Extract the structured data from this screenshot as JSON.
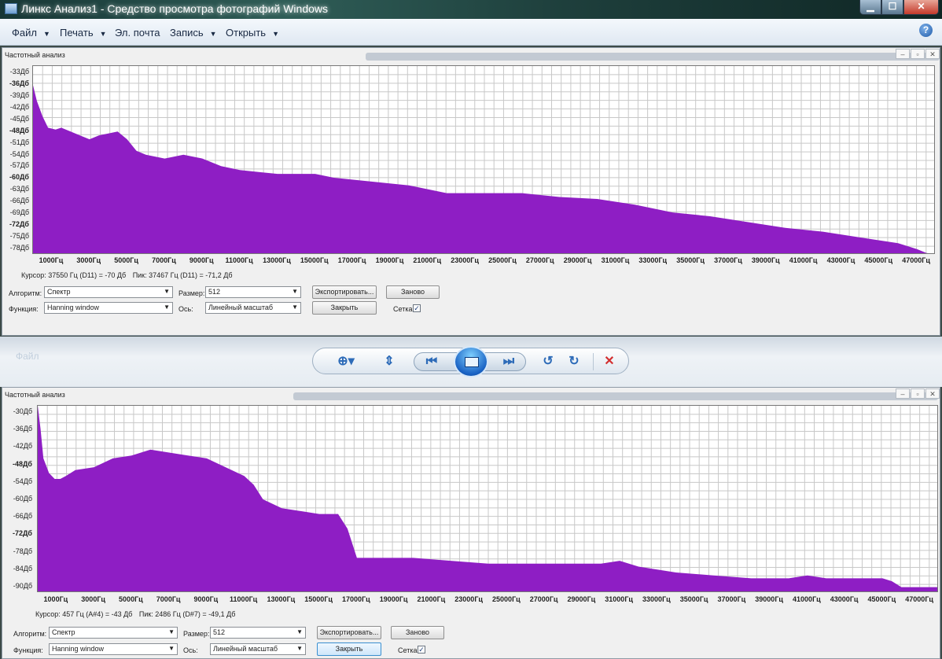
{
  "window": {
    "title": "Линкс Анализ1 - Средство просмотра фотографий Windows"
  },
  "menu": {
    "file": "Файл",
    "print": "Печать",
    "email": "Эл. почта",
    "burn": "Запись",
    "open": "Открыть"
  },
  "colors": {
    "spectrum_fill": "#8e1ec4",
    "grid": "#c8c8c8",
    "background_tint": "#3c4a48"
  },
  "top_panel": {
    "title": "Частотный анализ",
    "status": {
      "cursor": "Курсор: 37550 Гц (D11) = -70 Дб",
      "peak": "Пик: 37467 Гц (D11) = -71,2 Дб"
    },
    "controls": {
      "algorithm_label": "Алгоритм:",
      "algorithm_value": "Спектр",
      "size_label": "Размер:",
      "size_value": "512",
      "export_label": "Экспортировать...",
      "replot_label": "Заново",
      "function_label": "Функция:",
      "function_value": "Hanning window",
      "axis_label": "Ось:",
      "axis_value": "Линейный масштаб",
      "close_label": "Закрыть",
      "grid_label": "Сетка"
    },
    "ylabels": [
      {
        "text": "-33Дб",
        "bold": false
      },
      {
        "text": "-36Дб",
        "bold": true
      },
      {
        "text": "-39Дб",
        "bold": false
      },
      {
        "text": "-42Дб",
        "bold": false
      },
      {
        "text": "-45Дб",
        "bold": false
      },
      {
        "text": "-48Дб",
        "bold": true
      },
      {
        "text": "-51Дб",
        "bold": false
      },
      {
        "text": "-54Дб",
        "bold": false
      },
      {
        "text": "-57Дб",
        "bold": false
      },
      {
        "text": "-60Дб",
        "bold": true
      },
      {
        "text": "-63Дб",
        "bold": false
      },
      {
        "text": "-66Дб",
        "bold": false
      },
      {
        "text": "-69Дб",
        "bold": false
      },
      {
        "text": "-72Дб",
        "bold": true
      },
      {
        "text": "-75Дб",
        "bold": false
      },
      {
        "text": "-78Дб",
        "bold": false
      }
    ],
    "xlabels": [
      "1000Гц",
      "3000Гц",
      "5000Гц",
      "7000Гц",
      "9000Гц",
      "11000Гц",
      "13000Гц",
      "15000Гц",
      "17000Гц",
      "19000Гц",
      "21000Гц",
      "23000Гц",
      "25000Гц",
      "27000Гц",
      "29000Гц",
      "31000Гц",
      "33000Гц",
      "35000Гц",
      "37000Гц",
      "39000Гц",
      "41000Гц",
      "43000Гц",
      "45000Гц",
      "47000Гц"
    ]
  },
  "bottom_panel": {
    "title": "Частотный анализ",
    "status": {
      "cursor": "Курсор: 457 Гц (A#4) = -43 Дб",
      "peak": "Пик: 2486 Гц (D#7) = -49,1 Дб"
    },
    "controls": {
      "algorithm_label": "Алгоритм:",
      "algorithm_value": "Спектр",
      "size_label": "Размер:",
      "size_value": "512",
      "export_label": "Экспортировать...",
      "replot_label": "Заново",
      "function_label": "Функция:",
      "function_value": "Hanning window",
      "axis_label": "Ось:",
      "axis_value": "Линейный масштаб",
      "close_label": "Закрыть",
      "grid_label": "Сетка"
    },
    "ylabels": [
      {
        "text": "-30Дб",
        "bold": false
      },
      {
        "text": "-36Дб",
        "bold": false
      },
      {
        "text": "-42Дб",
        "bold": false
      },
      {
        "text": "-48Дб",
        "bold": true
      },
      {
        "text": "-54Дб",
        "bold": false
      },
      {
        "text": "-60Дб",
        "bold": false
      },
      {
        "text": "-66Дб",
        "bold": false
      },
      {
        "text": "-72Дб",
        "bold": true
      },
      {
        "text": "-78Дб",
        "bold": false
      },
      {
        "text": "-84Дб",
        "bold": false
      },
      {
        "text": "-90Дб",
        "bold": false
      }
    ],
    "xlabels": [
      "1000Гц",
      "3000Гц",
      "5000Гц",
      "7000Гц",
      "9000Гц",
      "11000Гц",
      "13000Гц",
      "15000Гц",
      "17000Гц",
      "19000Гц",
      "21000Гц",
      "23000Гц",
      "25000Гц",
      "27000Гц",
      "29000Гц",
      "31000Гц",
      "33000Гц",
      "35000Гц",
      "37000Гц",
      "39000Гц",
      "41000Гц",
      "43000Гц",
      "45000Гц",
      "47000Гц"
    ]
  },
  "chart_data": [
    {
      "type": "area",
      "x_unit": "Гц",
      "y_unit": "Дб",
      "xlim": [
        0,
        48000
      ],
      "ylim": [
        -80,
        -31
      ],
      "grid": true,
      "x": [
        0,
        200,
        500,
        800,
        1200,
        1500,
        2000,
        2500,
        3000,
        3500,
        4000,
        4500,
        5000,
        5500,
        6000,
        7000,
        8000,
        9000,
        10000,
        11000,
        12000,
        13000,
        14000,
        15000,
        16000,
        18000,
        20000,
        22000,
        24000,
        26000,
        28000,
        30000,
        32000,
        34000,
        36000,
        38000,
        40000,
        42000,
        44000,
        46000,
        47000,
        47500,
        48000
      ],
      "y": [
        -36,
        -40,
        -44,
        -47,
        -47.5,
        -47,
        -48,
        -49,
        -50,
        -49,
        -48.5,
        -48,
        -50,
        -53,
        -54,
        -55,
        -54,
        -55,
        -57,
        -58,
        -58.5,
        -59,
        -59,
        -59,
        -60,
        -61,
        -62,
        -64,
        -64,
        -64,
        -65,
        -65.5,
        -67,
        -69,
        -70,
        -71.5,
        -73,
        -74,
        -75.5,
        -77,
        -78.5,
        -79.5,
        -80
      ]
    },
    {
      "type": "area",
      "x_unit": "Гц",
      "y_unit": "Дб",
      "xlim": [
        0,
        48000
      ],
      "ylim": [
        -92,
        -28
      ],
      "grid": true,
      "x": [
        0,
        150,
        300,
        600,
        900,
        1200,
        1500,
        2000,
        3000,
        4000,
        5000,
        6000,
        7000,
        8000,
        9000,
        10000,
        11000,
        11500,
        12000,
        13000,
        14000,
        15000,
        16000,
        16500,
        17000,
        19000,
        20000,
        22000,
        24000,
        26000,
        28000,
        30000,
        31000,
        32000,
        34000,
        36000,
        38000,
        40000,
        41000,
        42000,
        44000,
        45000,
        45500,
        46000,
        48000
      ],
      "y": [
        -28,
        -36,
        -46,
        -51,
        -53,
        -53,
        -52,
        -50,
        -49,
        -46,
        -45,
        -43,
        -44,
        -45,
        -46,
        -49,
        -52,
        -55,
        -60,
        -63,
        -64,
        -65,
        -65,
        -70,
        -80,
        -80,
        -80,
        -81,
        -82,
        -82,
        -82,
        -82,
        -81,
        -83,
        -85,
        -86,
        -87,
        -87,
        -86,
        -87,
        -87,
        -87,
        -88,
        -90,
        -90
      ]
    }
  ]
}
